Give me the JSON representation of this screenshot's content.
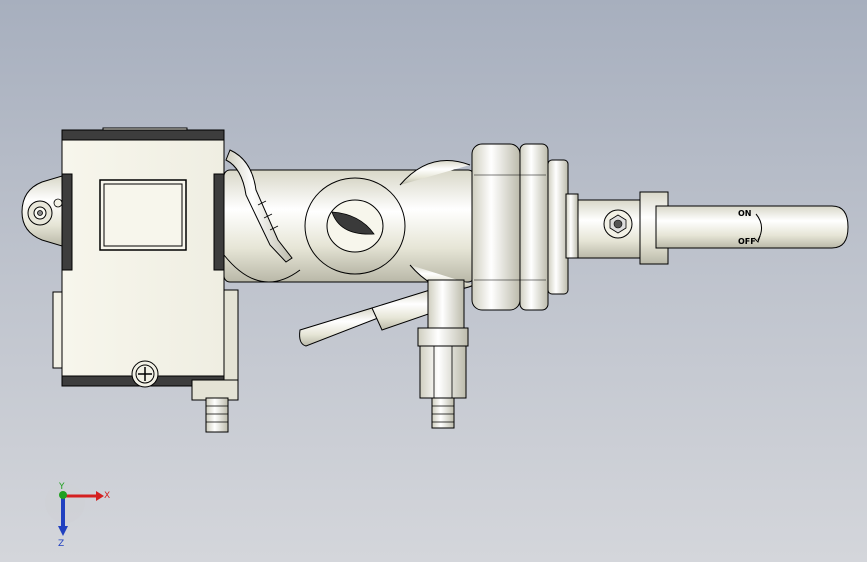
{
  "viewport": {
    "background_top": "#a7afbe",
    "background_bottom": "#d4d6db"
  },
  "model": {
    "part_color": "#f2f1e6",
    "edge_color": "#000000",
    "dark_band_color": "#4a4a4a",
    "handle": {
      "on_label": "ON",
      "off_label": "OFF"
    }
  },
  "triad": {
    "x_label": "X",
    "y_label": "Y",
    "z_label": "Z",
    "x_color": "#d42020",
    "y_color": "#20a020",
    "z_color": "#2040c0",
    "icon": "reference-triad-icon"
  }
}
